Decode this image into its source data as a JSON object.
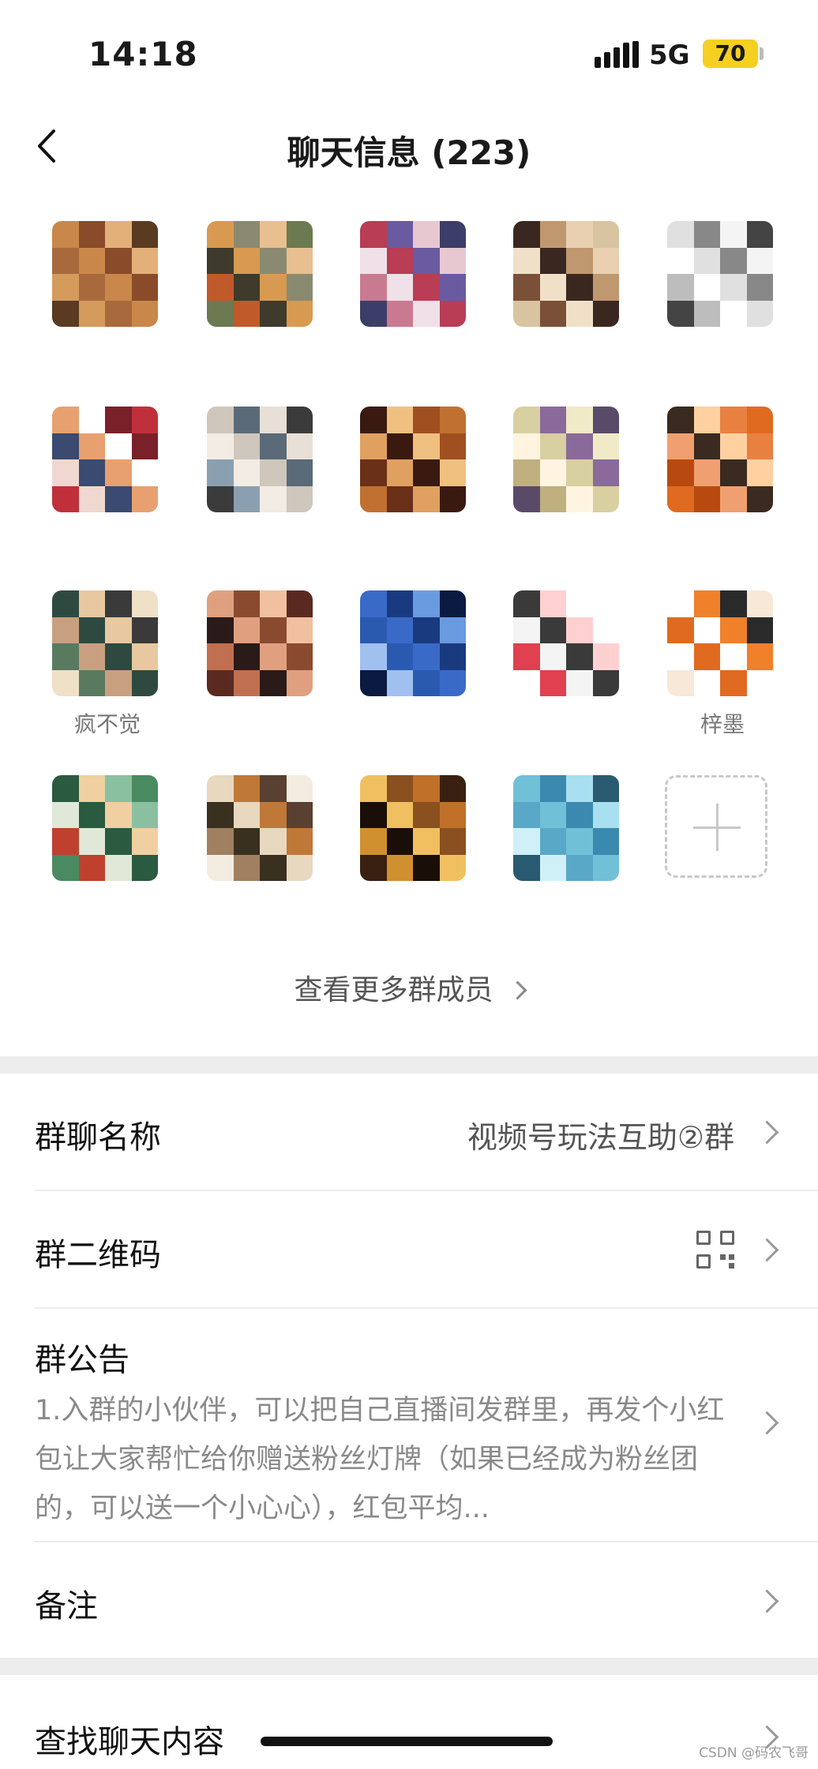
{
  "status_bar": {
    "time": "14:18",
    "network": "5G",
    "battery": "70"
  },
  "nav": {
    "title": "聊天信息 (223)"
  },
  "members": [
    {
      "name": ""
    },
    {
      "name": ""
    },
    {
      "name": ""
    },
    {
      "name": ""
    },
    {
      "name": ""
    },
    {
      "name": ""
    },
    {
      "name": ""
    },
    {
      "name": ""
    },
    {
      "name": ""
    },
    {
      "name": ""
    },
    {
      "name": "疯不觉"
    },
    {
      "name": ""
    },
    {
      "name": ""
    },
    {
      "name": ""
    },
    {
      "name": "梓墨"
    },
    {
      "name": ""
    },
    {
      "name": ""
    },
    {
      "name": ""
    },
    {
      "name": ""
    }
  ],
  "view_more": "查看更多群成员",
  "settings": {
    "group_name": {
      "label": "群聊名称",
      "value": "视频号玩法互助②群"
    },
    "qr_code": {
      "label": "群二维码"
    },
    "notice": {
      "label": "群公告",
      "text": "1.入群的小伙伴，可以把自己直播间发群里，再发个小红包让大家帮忙给你赠送粉丝灯牌（如果已经成为粉丝团的，可以送一个小心心），红包平均..."
    },
    "remark": {
      "label": "备注"
    },
    "search": {
      "label": "查找聊天内容"
    }
  },
  "watermark": "CSDN @码农飞哥",
  "colors": {
    "battery": "#f5d020",
    "separator": "#ededed"
  }
}
